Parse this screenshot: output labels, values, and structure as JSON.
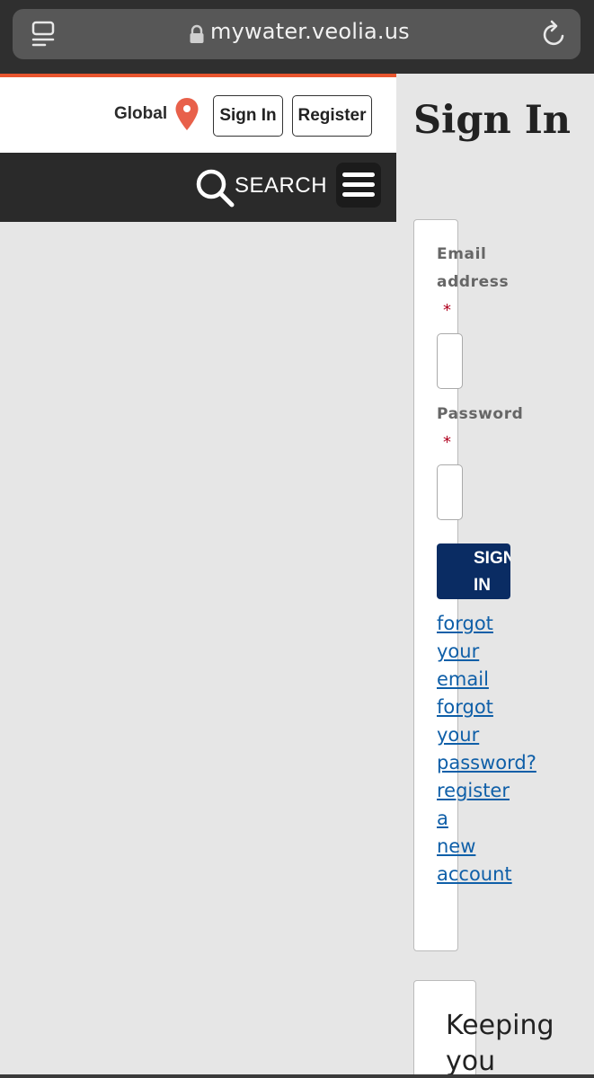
{
  "browser": {
    "url": "mywater.veolia.us"
  },
  "header": {
    "region_label": "Global",
    "sign_in_label": "Sign In",
    "register_label": "Register",
    "search_label": "SEARCH",
    "accent_color": "#e8552e"
  },
  "main": {
    "title": "Sign In",
    "form": {
      "email_label": "Email address",
      "email_value": "",
      "password_label": "Password",
      "password_value": "",
      "required_marker": "*",
      "submit_label": "SIGN IN",
      "submit_color": "#0a2c63",
      "forgot_email_link": "forgot your email",
      "forgot_password_link": "forgot your password?",
      "register_link": "register a new account",
      "link_color": "#0f5fa8"
    },
    "promo_card": {
      "title": "Keeping you"
    }
  }
}
